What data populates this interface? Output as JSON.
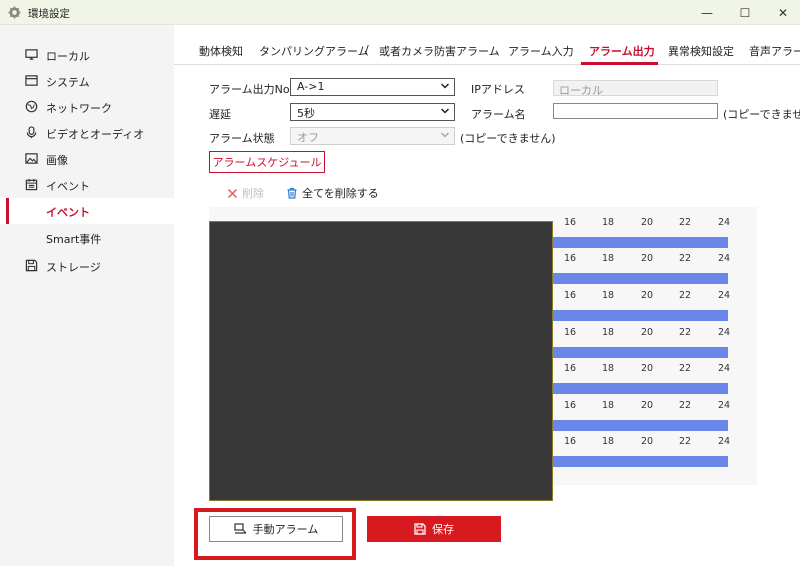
{
  "window": {
    "title": "環境設定",
    "minimize": "—",
    "maximize": "☐",
    "close": "✕"
  },
  "sidebar": {
    "items": [
      {
        "label": "ローカル",
        "icon": "monitor-icon"
      },
      {
        "label": "システム",
        "icon": "system-icon"
      },
      {
        "label": "ネットワーク",
        "icon": "globe-icon"
      },
      {
        "label": "ビデオとオーディオ",
        "icon": "mic-icon"
      },
      {
        "label": "画像",
        "icon": "image-icon"
      },
      {
        "label": "イベント",
        "icon": "calendar-icon"
      },
      {
        "label": "イベント",
        "icon": ""
      },
      {
        "label": "Smart事件",
        "icon": ""
      },
      {
        "label": "ストレージ",
        "icon": "save-icon"
      }
    ]
  },
  "tabs": [
    {
      "label": "動体検知"
    },
    {
      "label": "タンパリングアラーム"
    },
    {
      "label": "/"
    },
    {
      "label": "或者カメラ防害アラーム"
    },
    {
      "label": "アラーム入力"
    },
    {
      "label": "アラーム出力"
    },
    {
      "label": "異常検知設定"
    },
    {
      "label": "音声アラー"
    }
  ],
  "form": {
    "alarm_output_no_label": "アラーム出力No.",
    "alarm_output_no_value": "A->1",
    "delay_label": "遅延",
    "delay_value": "5秒",
    "alarm_status_label": "アラーム状態",
    "alarm_status_value": "オフ",
    "alarm_status_note": "(コピーできません)",
    "ip_label": "IPアドレス",
    "ip_value": "ローカル",
    "alarm_name_label": "アラーム名",
    "alarm_name_value": "",
    "alarm_name_note": "(コピーできませ"
  },
  "schedule": {
    "button": "アラームスケジュール",
    "delete_label": "削除",
    "delete_all_label": "全てを削除する",
    "tick_labels": [
      "16",
      "18",
      "20",
      "22",
      "24"
    ]
  },
  "footer": {
    "manual_alarm": "手動アラーム",
    "save": "保存"
  },
  "colors": {
    "accent": "#c8102e",
    "schedule_bar": "#6a86e8",
    "save_bg": "#d71920"
  }
}
